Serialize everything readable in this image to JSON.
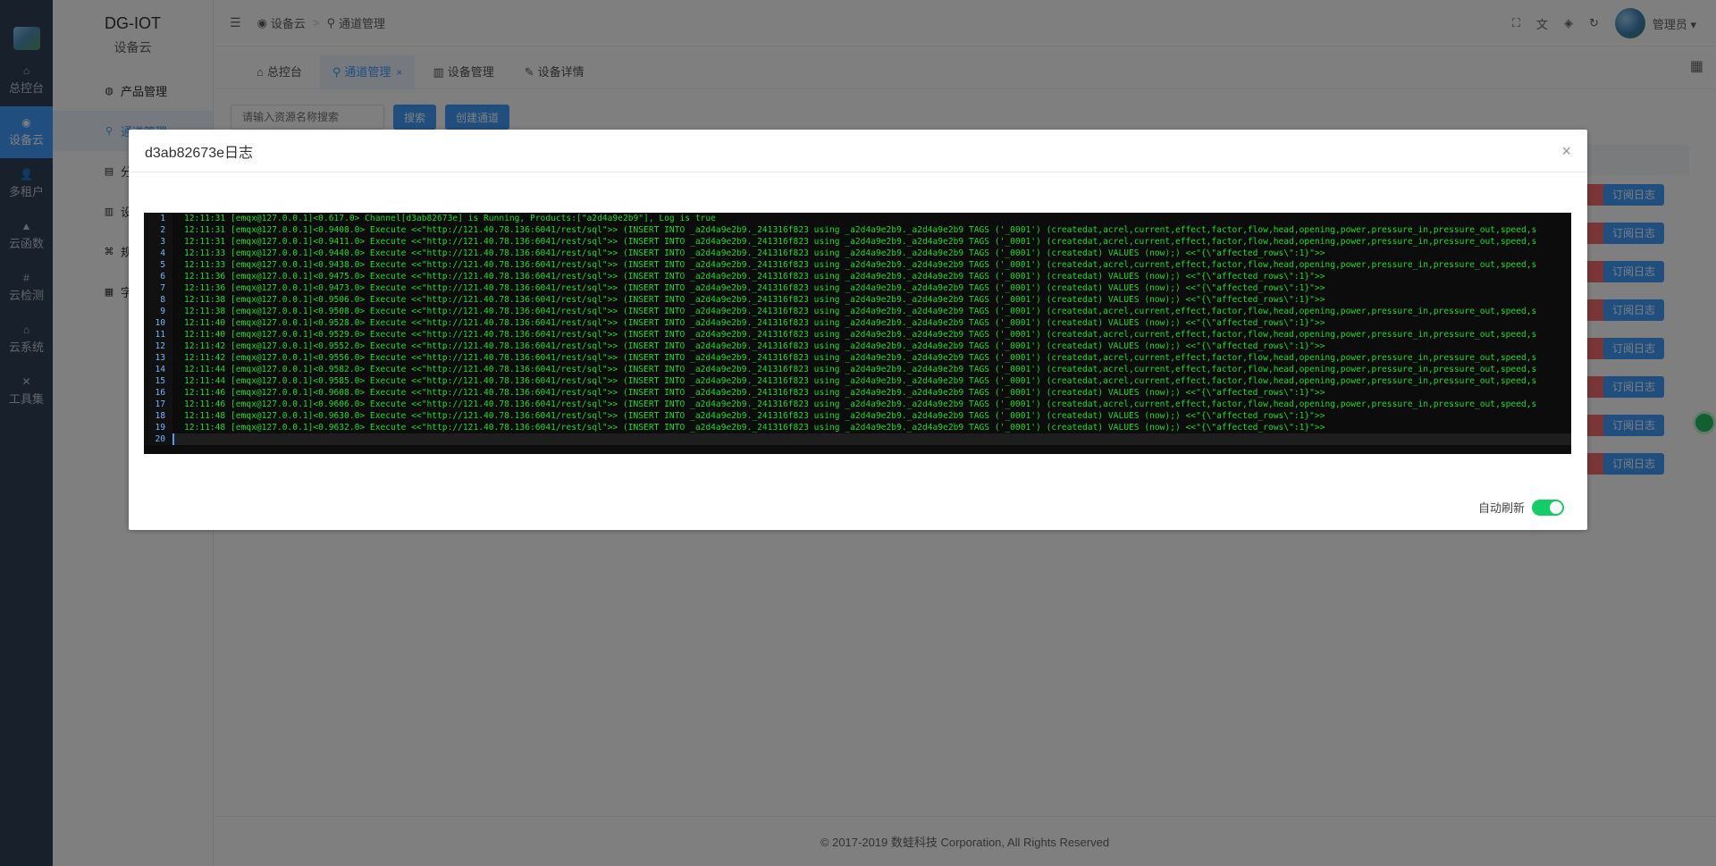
{
  "colors": {
    "primary": "#409eff",
    "danger": "#f56c6c",
    "success": "#13ce66",
    "rail_bg": "#304156"
  },
  "rail": {
    "items": [
      {
        "icon": "home-icon",
        "glyph": "⌂",
        "label": "总控台"
      },
      {
        "icon": "cloud-icon",
        "glyph": "◉",
        "label": "设备云"
      },
      {
        "icon": "user-icon",
        "glyph": "👤",
        "label": "多租户"
      },
      {
        "icon": "function-icon",
        "glyph": "▲",
        "label": "云函数"
      },
      {
        "icon": "hash-icon",
        "glyph": "#",
        "label": "云检测"
      },
      {
        "icon": "system-icon",
        "glyph": "⌂",
        "label": "云系统"
      },
      {
        "icon": "tools-icon",
        "glyph": "✕",
        "label": "工具集"
      }
    ],
    "active_index": 1
  },
  "sidebar": {
    "title": "DG-IOT",
    "subtitle": "设备云",
    "items": [
      {
        "icon": "product-icon",
        "glyph": "◍",
        "label": "产品管理"
      },
      {
        "icon": "channel-icon",
        "glyph": "⚲",
        "label": "通道管理"
      },
      {
        "icon": "doc-icon",
        "glyph": "▤",
        "label": "分"
      },
      {
        "icon": "device-icon",
        "glyph": "▥",
        "label": "设"
      },
      {
        "icon": "rule-icon",
        "glyph": "⌘",
        "label": "规"
      },
      {
        "icon": "dict-icon",
        "glyph": "▦",
        "label": "字"
      }
    ],
    "active_index": 1
  },
  "topbar": {
    "breadcrumb": [
      "设备云",
      "通道管理"
    ],
    "user": "管理员"
  },
  "tabs": [
    {
      "icon": "home-icon",
      "glyph": "⌂",
      "label": "总控台"
    },
    {
      "icon": "channel-icon",
      "glyph": "⚲",
      "label": "通道管理"
    },
    {
      "icon": "device-icon",
      "glyph": "▥",
      "label": "设备管理"
    },
    {
      "icon": "edit-icon",
      "glyph": "✎",
      "label": "设备详情"
    }
  ],
  "active_tab": 1,
  "toolbar": {
    "search_placeholder": "请输入资源名称搜索",
    "search_btn": "搜索",
    "create_btn": "创建通道"
  },
  "row_button_label": "订阅日志",
  "footer": "© 2017-2019 数蛙科技 Corporation, All Rights Reserved",
  "dialog": {
    "title": "d3ab82673e日志",
    "close": "×",
    "auto_refresh_label": "自动刷新",
    "auto_refresh": true,
    "log_lines": [
      "12:11:31 [emqx@127.0.0.1]<0.617.0> Channel[d3ab82673e] is Running, Products:[\"a2d4a9e2b9\"], Log is true",
      "12:11:31 [emqx@127.0.0.1]<0.9408.0> Execute <<\"http://121.40.78.136:6041/rest/sql\">> (INSERT INTO _a2d4a9e2b9._241316f823 using _a2d4a9e2b9._a2d4a9e2b9 TAGS ('_0001') (createdat,acrel,current,effect,factor,flow,head,opening,power,pressure_in,pressure_out,speed,s",
      "12:11:31 [emqx@127.0.0.1]<0.9411.0> Execute <<\"http://121.40.78.136:6041/rest/sql\">> (INSERT INTO _a2d4a9e2b9._241316f823 using _a2d4a9e2b9._a2d4a9e2b9 TAGS ('_0001') (createdat,acrel,current,effect,factor,flow,head,opening,power,pressure_in,pressure_out,speed,s",
      "12:11:33 [emqx@127.0.0.1]<0.9440.0> Execute <<\"http://121.40.78.136:6041/rest/sql\">> (INSERT INTO _a2d4a9e2b9._241316f823 using _a2d4a9e2b9._a2d4a9e2b9 TAGS ('_0001') (createdat) VALUES (now);) <<\"{\\\"affected_rows\\\":1}\">>",
      "12:11:33 [emqx@127.0.0.1]<0.9438.0> Execute <<\"http://121.40.78.136:6041/rest/sql\">> (INSERT INTO _a2d4a9e2b9._241316f823 using _a2d4a9e2b9._a2d4a9e2b9 TAGS ('_0001') (createdat,acrel,current,effect,factor,flow,head,opening,power,pressure_in,pressure_out,speed,s",
      "12:11:36 [emqx@127.0.0.1]<0.9475.0> Execute <<\"http://121.40.78.136:6041/rest/sql\">> (INSERT INTO _a2d4a9e2b9._241316f823 using _a2d4a9e2b9._a2d4a9e2b9 TAGS ('_0001') (createdat) VALUES (now);) <<\"{\\\"affected_rows\\\":1}\">>",
      "12:11:36 [emqx@127.0.0.1]<0.9473.0> Execute <<\"http://121.40.78.136:6041/rest/sql\">> (INSERT INTO _a2d4a9e2b9._241316f823 using _a2d4a9e2b9._a2d4a9e2b9 TAGS ('_0001') (createdat) VALUES (now);) <<\"{\\\"affected_rows\\\":1}\">>",
      "12:11:38 [emqx@127.0.0.1]<0.9506.0> Execute <<\"http://121.40.78.136:6041/rest/sql\">> (INSERT INTO _a2d4a9e2b9._241316f823 using _a2d4a9e2b9._a2d4a9e2b9 TAGS ('_0001') (createdat) VALUES (now);) <<\"{\\\"affected_rows\\\":1}\">>",
      "12:11:38 [emqx@127.0.0.1]<0.9508.0> Execute <<\"http://121.40.78.136:6041/rest/sql\">> (INSERT INTO _a2d4a9e2b9._241316f823 using _a2d4a9e2b9._a2d4a9e2b9 TAGS ('_0001') (createdat,acrel,current,effect,factor,flow,head,opening,power,pressure_in,pressure_out,speed,s",
      "12:11:40 [emqx@127.0.0.1]<0.9528.0> Execute <<\"http://121.40.78.136:6041/rest/sql\">> (INSERT INTO _a2d4a9e2b9._241316f823 using _a2d4a9e2b9._a2d4a9e2b9 TAGS ('_0001') (createdat) VALUES (now);) <<\"{\\\"affected_rows\\\":1}\">>",
      "12:11:40 [emqx@127.0.0.1]<0.9529.0> Execute <<\"http://121.40.78.136:6041/rest/sql\">> (INSERT INTO _a2d4a9e2b9._241316f823 using _a2d4a9e2b9._a2d4a9e2b9 TAGS ('_0001') (createdat,acrel,current,effect,factor,flow,head,opening,power,pressure_in,pressure_out,speed,s",
      "12:11:42 [emqx@127.0.0.1]<0.9552.0> Execute <<\"http://121.40.78.136:6041/rest/sql\">> (INSERT INTO _a2d4a9e2b9._241316f823 using _a2d4a9e2b9._a2d4a9e2b9 TAGS ('_0001') (createdat) VALUES (now);) <<\"{\\\"affected_rows\\\":1}\">>",
      "12:11:42 [emqx@127.0.0.1]<0.9556.0> Execute <<\"http://121.40.78.136:6041/rest/sql\">> (INSERT INTO _a2d4a9e2b9._241316f823 using _a2d4a9e2b9._a2d4a9e2b9 TAGS ('_0001') (createdat,acrel,current,effect,factor,flow,head,opening,power,pressure_in,pressure_out,speed,s",
      "12:11:44 [emqx@127.0.0.1]<0.9582.0> Execute <<\"http://121.40.78.136:6041/rest/sql\">> (INSERT INTO _a2d4a9e2b9._241316f823 using _a2d4a9e2b9._a2d4a9e2b9 TAGS ('_0001') (createdat,acrel,current,effect,factor,flow,head,opening,power,pressure_in,pressure_out,speed,s",
      "12:11:44 [emqx@127.0.0.1]<0.9585.0> Execute <<\"http://121.40.78.136:6041/rest/sql\">> (INSERT INTO _a2d4a9e2b9._241316f823 using _a2d4a9e2b9._a2d4a9e2b9 TAGS ('_0001') (createdat,acrel,current,effect,factor,flow,head,opening,power,pressure_in,pressure_out,speed,s",
      "12:11:46 [emqx@127.0.0.1]<0.9608.0> Execute <<\"http://121.40.78.136:6041/rest/sql\">> (INSERT INTO _a2d4a9e2b9._241316f823 using _a2d4a9e2b9._a2d4a9e2b9 TAGS ('_0001') (createdat) VALUES (now);) <<\"{\\\"affected_rows\\\":1}\">>",
      "12:11:46 [emqx@127.0.0.1]<0.9606.0> Execute <<\"http://121.40.78.136:6041/rest/sql\">> (INSERT INTO _a2d4a9e2b9._241316f823 using _a2d4a9e2b9._a2d4a9e2b9 TAGS ('_0001') (createdat,acrel,current,effect,factor,flow,head,opening,power,pressure_in,pressure_out,speed,s",
      "12:11:48 [emqx@127.0.0.1]<0.9630.0> Execute <<\"http://121.40.78.136:6041/rest/sql\">> (INSERT INTO _a2d4a9e2b9._241316f823 using _a2d4a9e2b9._a2d4a9e2b9 TAGS ('_0001') (createdat) VALUES (now);) <<\"{\\\"affected_rows\\\":1}\">>",
      "12:11:48 [emqx@127.0.0.1]<0.9632.0> Execute <<\"http://121.40.78.136:6041/rest/sql\">> (INSERT INTO _a2d4a9e2b9._241316f823 using _a2d4a9e2b9._a2d4a9e2b9 TAGS ('_0001') (createdat) VALUES (now);) <<\"{\\\"affected_rows\\\":1}\">>",
      ""
    ]
  }
}
